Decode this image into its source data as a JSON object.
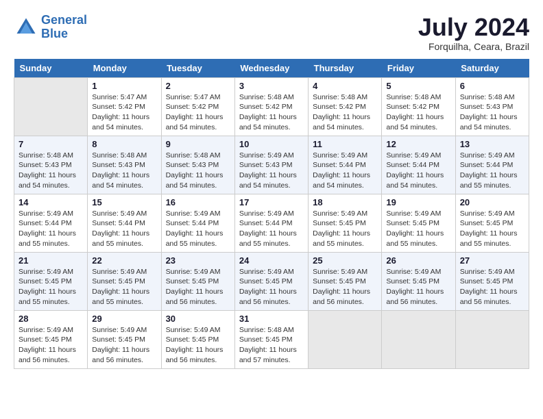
{
  "header": {
    "logo_line1": "General",
    "logo_line2": "Blue",
    "month_year": "July 2024",
    "location": "Forquilha, Ceara, Brazil"
  },
  "calendar": {
    "days_of_week": [
      "Sunday",
      "Monday",
      "Tuesday",
      "Wednesday",
      "Thursday",
      "Friday",
      "Saturday"
    ],
    "weeks": [
      [
        {
          "day": "",
          "empty": true
        },
        {
          "day": "1",
          "sunrise": "5:47 AM",
          "sunset": "5:42 PM",
          "daylight": "11 hours and 54 minutes."
        },
        {
          "day": "2",
          "sunrise": "5:47 AM",
          "sunset": "5:42 PM",
          "daylight": "11 hours and 54 minutes."
        },
        {
          "day": "3",
          "sunrise": "5:48 AM",
          "sunset": "5:42 PM",
          "daylight": "11 hours and 54 minutes."
        },
        {
          "day": "4",
          "sunrise": "5:48 AM",
          "sunset": "5:42 PM",
          "daylight": "11 hours and 54 minutes."
        },
        {
          "day": "5",
          "sunrise": "5:48 AM",
          "sunset": "5:42 PM",
          "daylight": "11 hours and 54 minutes."
        },
        {
          "day": "6",
          "sunrise": "5:48 AM",
          "sunset": "5:43 PM",
          "daylight": "11 hours and 54 minutes."
        }
      ],
      [
        {
          "day": "7",
          "sunrise": "5:48 AM",
          "sunset": "5:43 PM",
          "daylight": "11 hours and 54 minutes."
        },
        {
          "day": "8",
          "sunrise": "5:48 AM",
          "sunset": "5:43 PM",
          "daylight": "11 hours and 54 minutes."
        },
        {
          "day": "9",
          "sunrise": "5:48 AM",
          "sunset": "5:43 PM",
          "daylight": "11 hours and 54 minutes."
        },
        {
          "day": "10",
          "sunrise": "5:49 AM",
          "sunset": "5:43 PM",
          "daylight": "11 hours and 54 minutes."
        },
        {
          "day": "11",
          "sunrise": "5:49 AM",
          "sunset": "5:44 PM",
          "daylight": "11 hours and 54 minutes."
        },
        {
          "day": "12",
          "sunrise": "5:49 AM",
          "sunset": "5:44 PM",
          "daylight": "11 hours and 54 minutes."
        },
        {
          "day": "13",
          "sunrise": "5:49 AM",
          "sunset": "5:44 PM",
          "daylight": "11 hours and 55 minutes."
        }
      ],
      [
        {
          "day": "14",
          "sunrise": "5:49 AM",
          "sunset": "5:44 PM",
          "daylight": "11 hours and 55 minutes."
        },
        {
          "day": "15",
          "sunrise": "5:49 AM",
          "sunset": "5:44 PM",
          "daylight": "11 hours and 55 minutes."
        },
        {
          "day": "16",
          "sunrise": "5:49 AM",
          "sunset": "5:44 PM",
          "daylight": "11 hours and 55 minutes."
        },
        {
          "day": "17",
          "sunrise": "5:49 AM",
          "sunset": "5:44 PM",
          "daylight": "11 hours and 55 minutes."
        },
        {
          "day": "18",
          "sunrise": "5:49 AM",
          "sunset": "5:45 PM",
          "daylight": "11 hours and 55 minutes."
        },
        {
          "day": "19",
          "sunrise": "5:49 AM",
          "sunset": "5:45 PM",
          "daylight": "11 hours and 55 minutes."
        },
        {
          "day": "20",
          "sunrise": "5:49 AM",
          "sunset": "5:45 PM",
          "daylight": "11 hours and 55 minutes."
        }
      ],
      [
        {
          "day": "21",
          "sunrise": "5:49 AM",
          "sunset": "5:45 PM",
          "daylight": "11 hours and 55 minutes."
        },
        {
          "day": "22",
          "sunrise": "5:49 AM",
          "sunset": "5:45 PM",
          "daylight": "11 hours and 55 minutes."
        },
        {
          "day": "23",
          "sunrise": "5:49 AM",
          "sunset": "5:45 PM",
          "daylight": "11 hours and 56 minutes."
        },
        {
          "day": "24",
          "sunrise": "5:49 AM",
          "sunset": "5:45 PM",
          "daylight": "11 hours and 56 minutes."
        },
        {
          "day": "25",
          "sunrise": "5:49 AM",
          "sunset": "5:45 PM",
          "daylight": "11 hours and 56 minutes."
        },
        {
          "day": "26",
          "sunrise": "5:49 AM",
          "sunset": "5:45 PM",
          "daylight": "11 hours and 56 minutes."
        },
        {
          "day": "27",
          "sunrise": "5:49 AM",
          "sunset": "5:45 PM",
          "daylight": "11 hours and 56 minutes."
        }
      ],
      [
        {
          "day": "28",
          "sunrise": "5:49 AM",
          "sunset": "5:45 PM",
          "daylight": "11 hours and 56 minutes."
        },
        {
          "day": "29",
          "sunrise": "5:49 AM",
          "sunset": "5:45 PM",
          "daylight": "11 hours and 56 minutes."
        },
        {
          "day": "30",
          "sunrise": "5:49 AM",
          "sunset": "5:45 PM",
          "daylight": "11 hours and 56 minutes."
        },
        {
          "day": "31",
          "sunrise": "5:48 AM",
          "sunset": "5:45 PM",
          "daylight": "11 hours and 57 minutes."
        },
        {
          "day": "",
          "empty": true
        },
        {
          "day": "",
          "empty": true
        },
        {
          "day": "",
          "empty": true
        }
      ]
    ]
  }
}
